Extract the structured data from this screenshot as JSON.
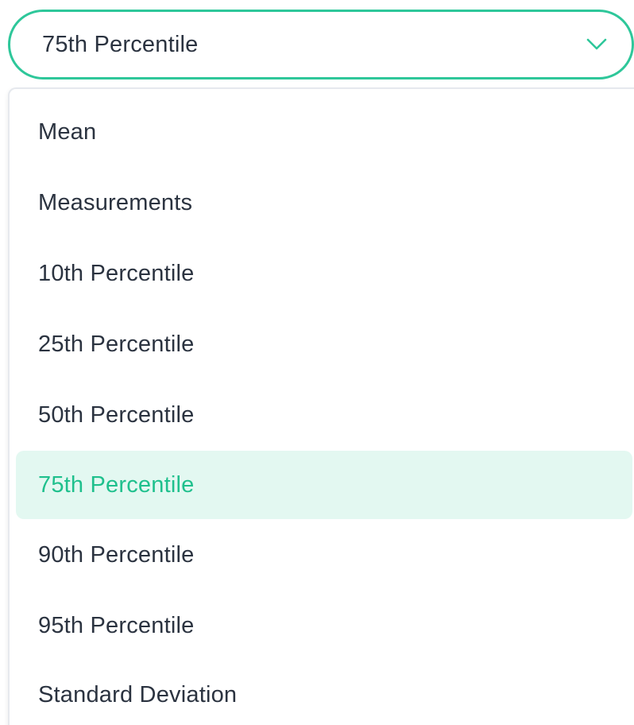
{
  "select": {
    "value": "75th Percentile",
    "icon": "chevron-down-icon",
    "accent_color": "#2ec79a"
  },
  "options": [
    {
      "label": "Mean",
      "selected": false
    },
    {
      "label": "Measurements",
      "selected": false
    },
    {
      "label": "10th Percentile",
      "selected": false
    },
    {
      "label": "25th Percentile",
      "selected": false
    },
    {
      "label": "50th Percentile",
      "selected": false
    },
    {
      "label": "75th Percentile",
      "selected": true
    },
    {
      "label": "90th Percentile",
      "selected": false
    },
    {
      "label": "95th Percentile",
      "selected": false
    },
    {
      "label": "Standard Deviation",
      "selected": false
    }
  ],
  "colors": {
    "text": "#2b3340",
    "selected_text": "#1fc08d",
    "selected_background": "#e3f8f1"
  }
}
